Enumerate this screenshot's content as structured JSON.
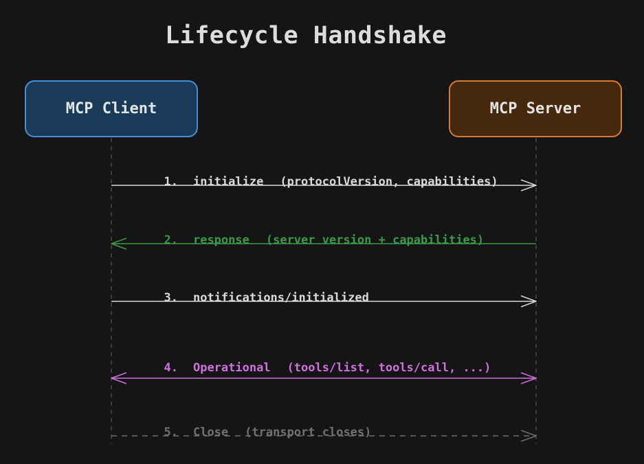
{
  "title": "Lifecycle Handshake",
  "actors": {
    "client": {
      "label": "MCP Client",
      "fill": "#1a3a5a",
      "stroke": "#4a90d9"
    },
    "server": {
      "label": "MCP Server",
      "fill": "#46290d",
      "stroke": "#d77a35"
    }
  },
  "messages": [
    {
      "num": "1.",
      "name": "initialize",
      "args": "(protocolVersion, capabilities)",
      "direction": "client-to-server",
      "style": "solid",
      "color": "#d8d8d8"
    },
    {
      "num": "2.",
      "name": "response",
      "args": "(server version + capabilities)",
      "direction": "server-to-client",
      "style": "solid",
      "color": "#3a9a4a"
    },
    {
      "num": "3.",
      "name": "notifications/initialized",
      "args": "",
      "direction": "client-to-server",
      "style": "solid",
      "color": "#d8d8d8"
    },
    {
      "num": "4.",
      "name": "Operational",
      "args": "(tools/list, tools/call, ...)",
      "direction": "bidirectional",
      "style": "solid",
      "color": "#d070e0"
    },
    {
      "num": "5.",
      "name": "Close",
      "args": "(transport closes)",
      "direction": "client-to-server",
      "style": "dashed",
      "color": "#707070"
    }
  ]
}
